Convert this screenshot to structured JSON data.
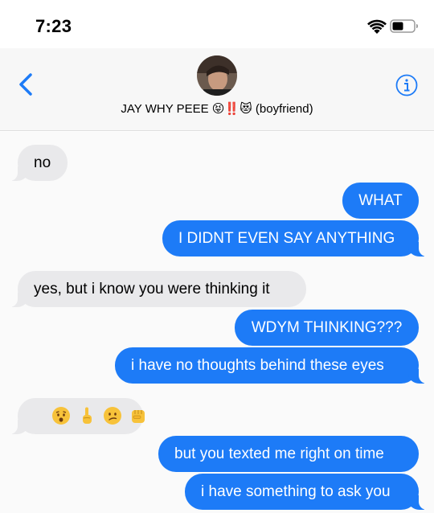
{
  "status": {
    "time": "7:23"
  },
  "header": {
    "contact_name": "JAY WHY PEEE 😝‼️😻 (boyfriend)",
    "back_icon": "chevron-left-icon",
    "info_icon": "info-icon"
  },
  "colors": {
    "accent": "#1d7bf7",
    "incoming": "#e9e9eb",
    "outgoing": "#1d7bf7"
  },
  "messages": [
    {
      "direction": "in",
      "text": "no"
    },
    {
      "direction": "out",
      "text": "WHAT"
    },
    {
      "direction": "out",
      "text": "I DIDNT EVEN SAY ANYTHING"
    },
    {
      "direction": "in",
      "text": "yes, but i know you were thinking it"
    },
    {
      "direction": "out",
      "text": "WDYM THINKING???"
    },
    {
      "direction": "out",
      "text": "i have no thoughts behind these eyes"
    },
    {
      "direction": "in",
      "text": "",
      "emojis": [
        "worried-face-icon",
        "pointing-up-icon",
        "confused-face-icon",
        "raised-fist-icon"
      ]
    },
    {
      "direction": "out",
      "text": "but you texted me right on time"
    },
    {
      "direction": "out",
      "text": "i have something to ask you"
    }
  ]
}
